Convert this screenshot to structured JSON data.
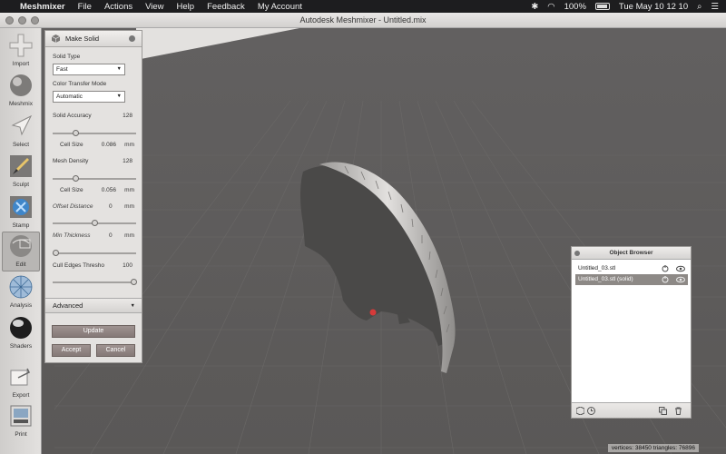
{
  "menubar": {
    "app_name": "Meshmixer",
    "items": [
      "File",
      "Actions",
      "View",
      "Help",
      "Feedback",
      "My Account"
    ],
    "battery": "100%",
    "datetime": "Tue May 10  12 10"
  },
  "window": {
    "title": "Autodesk Meshmixer - Untitled.mix"
  },
  "toolbar": {
    "items": [
      {
        "label": "Import",
        "icon": "plus-icon"
      },
      {
        "label": "Meshmix",
        "icon": "sphere-icon"
      },
      {
        "label": "Select",
        "icon": "cursor-arrow-icon"
      },
      {
        "label": "Sculpt",
        "icon": "brush-icon"
      },
      {
        "label": "Stamp",
        "icon": "stamp-icon"
      },
      {
        "label": "Edit",
        "icon": "edit-sphere-icon"
      },
      {
        "label": "Analysis",
        "icon": "analysis-sphere-icon"
      },
      {
        "label": "Shaders",
        "icon": "shader-sphere-icon"
      },
      {
        "label": "Export",
        "icon": "export-icon"
      },
      {
        "label": "Print",
        "icon": "printer-icon"
      }
    ]
  },
  "panel": {
    "title": "Make Solid",
    "solid_type_label": "Solid Type",
    "solid_type_value": "Fast",
    "color_transfer_label": "Color Transfer Mode",
    "color_transfer_value": "Automatic",
    "solid_accuracy_label": "Solid Accuracy",
    "solid_accuracy_value": "128",
    "cell_size_label": "Cell Size",
    "cell_size_1_value": "0.086",
    "unit_mm": "mm",
    "mesh_density_label": "Mesh Density",
    "mesh_density_value": "128",
    "cell_size_2_value": "0.056",
    "offset_distance_label": "Offset Distance",
    "offset_distance_value": "0",
    "min_thickness_label": "Min Thickness",
    "min_thickness_value": "0",
    "cull_edges_label": "Cull Edges Thresho",
    "cull_edges_value": "100",
    "advanced_label": "Advanced",
    "update_label": "Update",
    "accept_label": "Accept",
    "cancel_label": "Cancel",
    "sliders": {
      "solid_accuracy": 0.25,
      "mesh_density": 0.25,
      "offset_distance": 0.5,
      "min_thickness": 0.0,
      "cull_edges": 1.0
    }
  },
  "object_browser": {
    "title": "Object Browser",
    "items": [
      {
        "name": "Untitled_03.stl",
        "selected": false
      },
      {
        "name": "Untitled_03.stl (solid)",
        "selected": true
      }
    ]
  },
  "status": {
    "text": "vertices: 38450  triangles: 76896"
  },
  "colors": {
    "viewport_bg": "#5f5d5c",
    "mesh_dark": "#4a4948",
    "mesh_light": "#cfcdcb",
    "selected_row": "#8d8986",
    "button": "#8f8381",
    "pivot_red": "#d63a3a"
  }
}
